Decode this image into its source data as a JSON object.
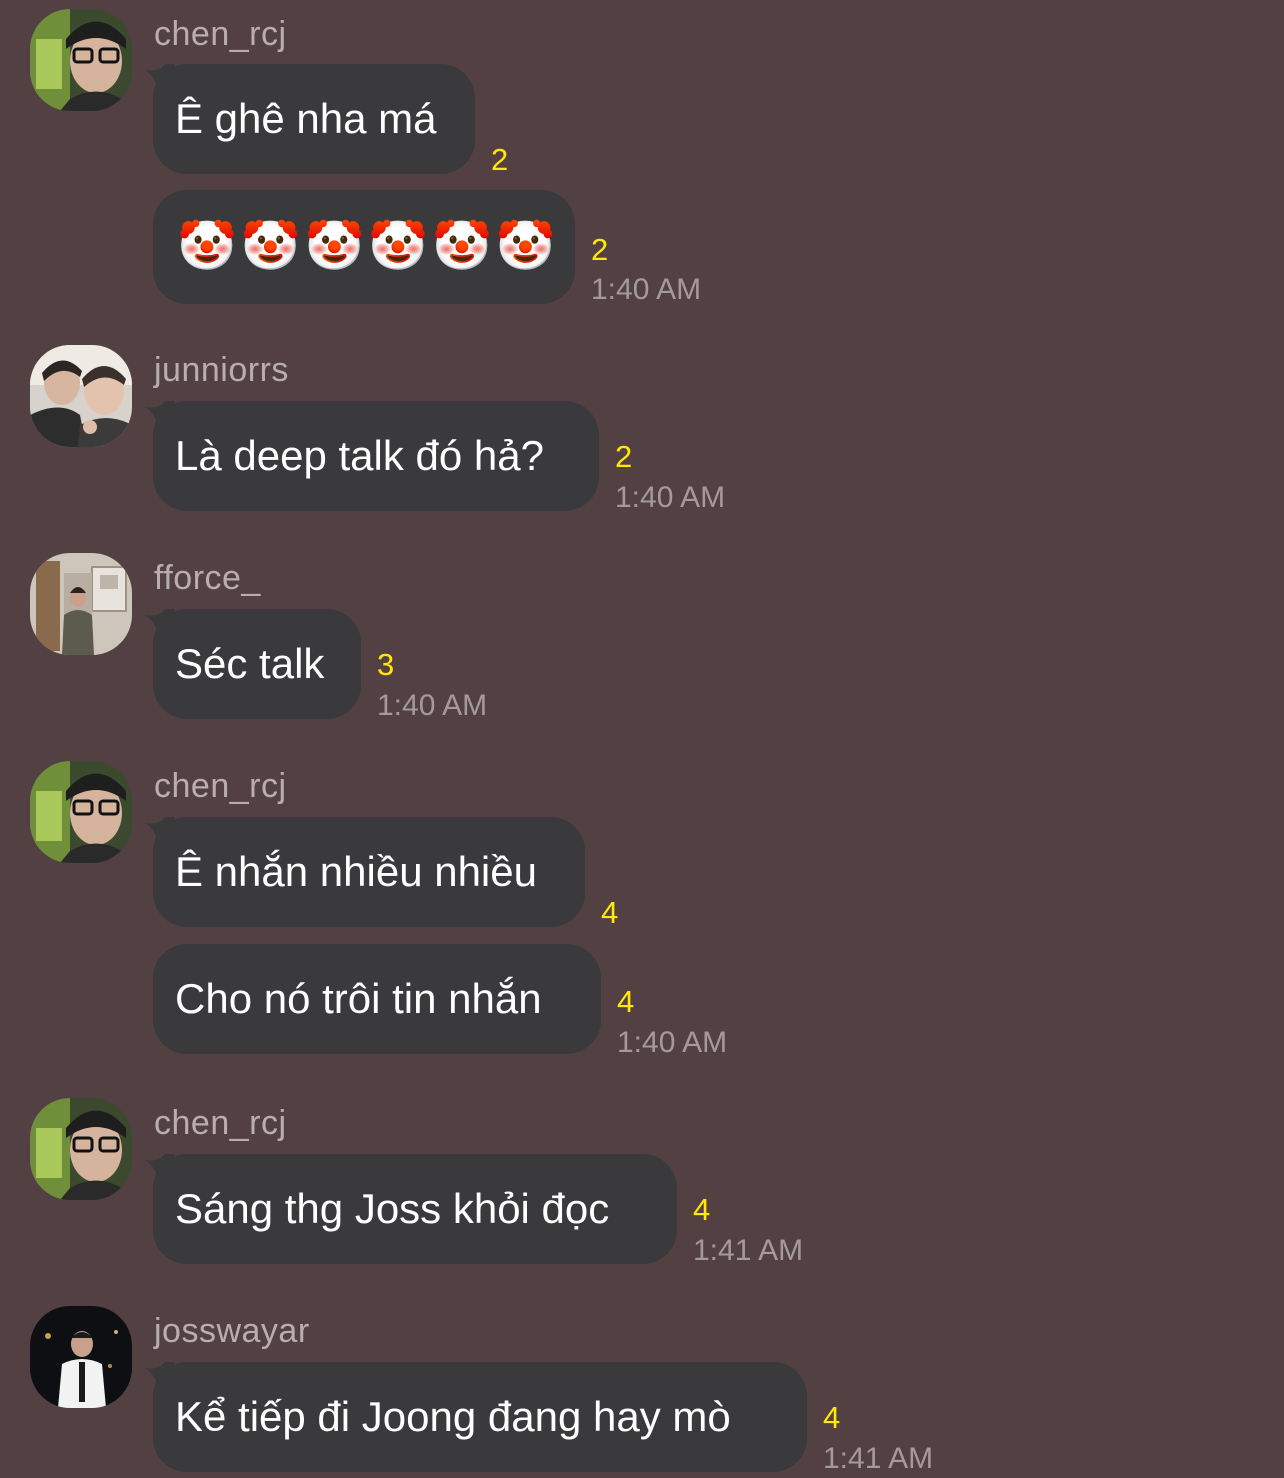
{
  "messages": [
    {
      "user": "chen_rcj",
      "items": [
        {
          "text": "Ê ghê nha má",
          "count": "2"
        },
        {
          "text": "🤡🤡🤡🤡🤡🤡",
          "count": "2",
          "time": "1:40 AM"
        }
      ]
    },
    {
      "user": "junniorrs",
      "items": [
        {
          "text": "Là deep talk đó hả?",
          "count": "2",
          "time": "1:40 AM"
        }
      ]
    },
    {
      "user": "fforce_",
      "items": [
        {
          "text": "Séc talk",
          "count": "3",
          "time": "1:40 AM"
        }
      ]
    },
    {
      "user": "chen_rcj",
      "items": [
        {
          "text": "Ê nhắn nhiều nhiều",
          "count": "4"
        },
        {
          "text": "Cho nó trôi tin nhắn",
          "count": "4",
          "time": "1:40 AM"
        }
      ]
    },
    {
      "user": "chen_rcj",
      "items": [
        {
          "text": "Sáng thg Joss khỏi đọc",
          "count": "4",
          "time": "1:41 AM"
        }
      ]
    },
    {
      "user": "josswayar",
      "items": [
        {
          "text": "Kể tiếp đi Joong đang hay mò",
          "count": "4",
          "time": "1:41 AM"
        }
      ]
    }
  ],
  "avatars": [
    "avatar-glasses-man",
    "avatar-two-men",
    "avatar-mirror-selfie",
    "avatar-glasses-man",
    "avatar-glasses-man",
    "avatar-white-shirt-man"
  ]
}
